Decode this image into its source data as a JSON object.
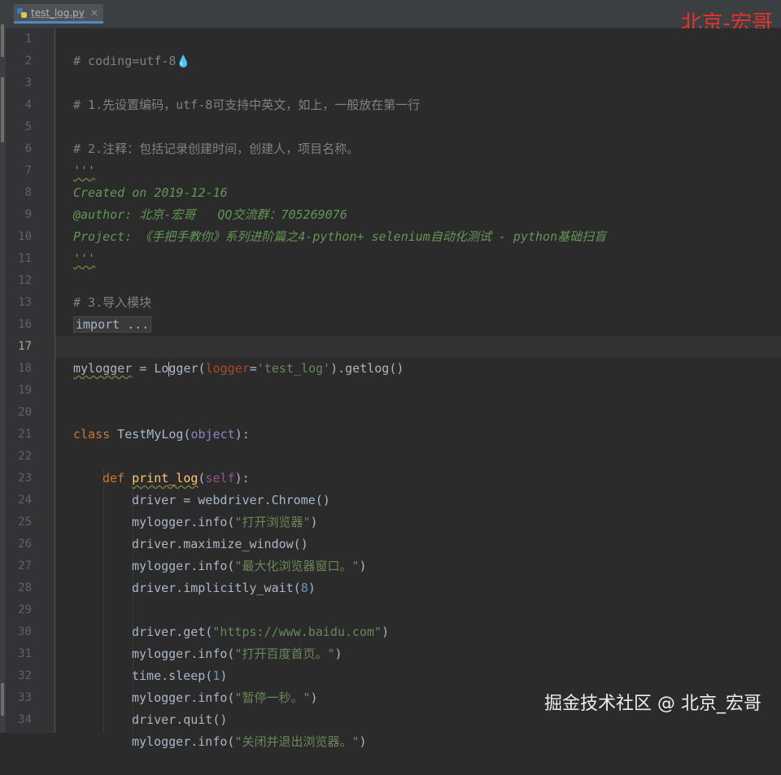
{
  "tab": {
    "file_name": "test_log.py",
    "close_glyph": "✕",
    "icon": "python-file-icon"
  },
  "watermarks": {
    "top": "北京-宏哥",
    "bottom": "掘金技术社区 @ 北京_宏哥"
  },
  "editor": {
    "current_line": 17,
    "line_numbers": [
      "1",
      "2",
      "3",
      "4",
      "5",
      "6",
      "7",
      "8",
      "9",
      "10",
      "11",
      "12",
      "13",
      "16",
      "17",
      "18",
      "19",
      "20",
      "21",
      "22",
      "23",
      "24",
      "25",
      "26",
      "27",
      "28",
      "29",
      "30",
      "31",
      "32",
      "33",
      "34"
    ],
    "lines": {
      "l1": "# coding=utf-8",
      "l3": "# 1.先设置编码，utf-8可支持中英文，如上，一般放在第一行",
      "l5": "# 2.注释：包括记录创建时间，创建人，项目名称。",
      "l6": "'''",
      "l7": "Created on 2019-12-16",
      "l8": "@author: 北京-宏哥   QQ交流群：705269076",
      "l9": "Project: 《手把手教你》系列进阶篇之4-python+ selenium自动化测试 - python基础扫盲",
      "l10": "'''",
      "l12": "# 3.导入模块",
      "l13": "import ...",
      "l17": {
        "var": "mylogger",
        "eq": " = ",
        "cls_a": "Lo",
        "cls_b": "gger",
        "open": "(",
        "param": "logger",
        "assign": "=",
        "str": "'test_log'",
        "rest": ").getlog()"
      },
      "l20": {
        "kw": "class",
        "name": " TestMyLog(",
        "base": "object",
        "end": "):"
      },
      "l22": {
        "kw": "def",
        "name": "print_log",
        "open": "(",
        "self": "self",
        "end": "):"
      },
      "l23": "driver = webdriver.Chrome()",
      "l24": {
        "call": "mylogger.info(",
        "str": "\"打开浏览器\"",
        "end": ")"
      },
      "l25": "driver.maximize_window()",
      "l26": {
        "call": "mylogger.info(",
        "str": "\"最大化浏览器窗口。\"",
        "end": ")"
      },
      "l27": {
        "call": "driver.implicitly_wait(",
        "num": "8",
        "end": ")"
      },
      "l29": {
        "call": "driver.get(",
        "str": "\"https://www.baidu.com\"",
        "end": ")"
      },
      "l30": {
        "call": "mylogger.info(",
        "str": "\"打开百度首页。\"",
        "end": ")"
      },
      "l31": {
        "call": "time.sleep(",
        "num": "1",
        "end": ")"
      },
      "l32": {
        "call": "mylogger.info(",
        "str": "\"暂停一秒。\"",
        "end": ")"
      },
      "l33": "driver.quit()",
      "l34": {
        "call": "mylogger.info(",
        "str": "\"关闭并退出浏览器。\"",
        "end": ")"
      }
    }
  },
  "colors": {
    "comment": "#808080",
    "docstring": "#629755",
    "keyword": "#cc7832",
    "string": "#6a8759",
    "number": "#6897bb",
    "function": "#ffc66d",
    "watermark": "#e5342c"
  }
}
